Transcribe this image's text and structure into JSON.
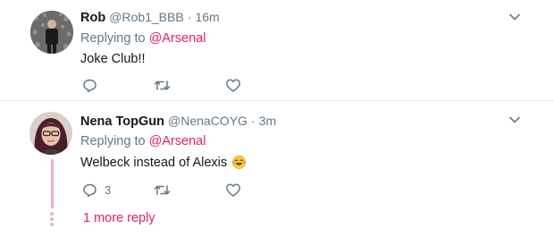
{
  "tweets": [
    {
      "name": "Rob",
      "handle": "@Rob1_BBB",
      "separator": "·",
      "time": "16m",
      "replying_to_prefix": "Replying to",
      "replying_to_mention": "@Arsenal",
      "text": "Joke Club!!",
      "actions": {
        "reply_count": "",
        "retweet_count": "",
        "like_count": ""
      }
    },
    {
      "name": "Nena TopGun",
      "handle": "@NenaCOYG",
      "separator": "·",
      "time": "3m",
      "replying_to_prefix": "Replying to",
      "replying_to_mention": "@Arsenal",
      "text": "Welbeck instead of Alexis",
      "emoji": "crying-laughing-emoji",
      "actions": {
        "reply_count": "3",
        "retweet_count": "",
        "like_count": ""
      }
    }
  ],
  "more_replies": "1 more reply",
  "colors": {
    "accent": "#e0245e",
    "secondary_text": "#657786",
    "thread_line": "#e9b3bf",
    "divider": "#e6ecf0"
  }
}
